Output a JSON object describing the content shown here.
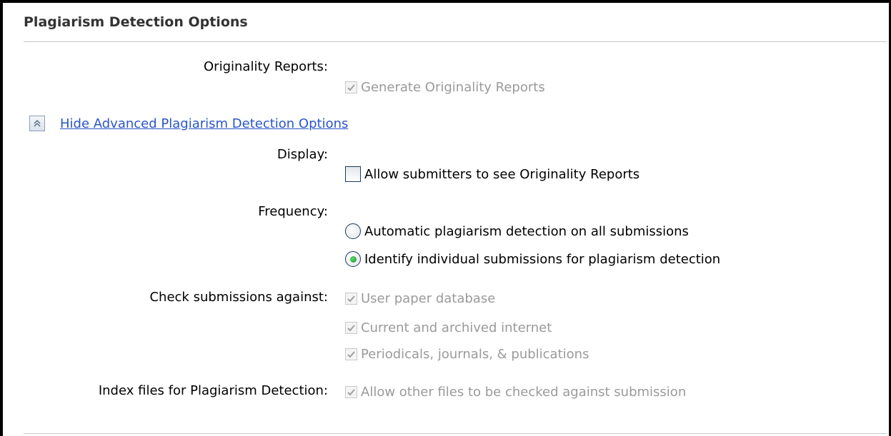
{
  "section": {
    "title": "Plagiarism Detection Options"
  },
  "originality": {
    "label": "Originality Reports:",
    "generate_label": "Generate Originality Reports",
    "generate_checked": true,
    "generate_disabled": true
  },
  "advanced_toggle": {
    "label": "Hide Advanced Plagiarism Detection Options",
    "icon": "double-chevron-up-icon"
  },
  "display": {
    "label": "Display:",
    "allow_label": "Allow submitters to see Originality Reports",
    "allow_checked": false
  },
  "frequency": {
    "label": "Frequency:",
    "options": [
      {
        "label": "Automatic plagiarism detection on all submissions",
        "selected": false
      },
      {
        "label": "Identify individual submissions for plagiarism detection",
        "selected": true
      }
    ]
  },
  "check_against": {
    "label": "Check submissions against:",
    "options": [
      {
        "label": "User paper database",
        "checked": true,
        "disabled": true
      },
      {
        "label": "Current and archived internet",
        "checked": true,
        "disabled": true
      },
      {
        "label": "Periodicals, journals, & publications",
        "checked": true,
        "disabled": true
      }
    ]
  },
  "index_files": {
    "label": "Index files for Plagiarism Detection:",
    "allow_label": "Allow other files to be checked against submission",
    "allow_checked": true,
    "allow_disabled": true
  },
  "colors": {
    "link": "#2a55c8",
    "disabled_text": "#9a9a9a",
    "radio_selected": "#1a8a2a",
    "rule": "#c6c6c6"
  }
}
